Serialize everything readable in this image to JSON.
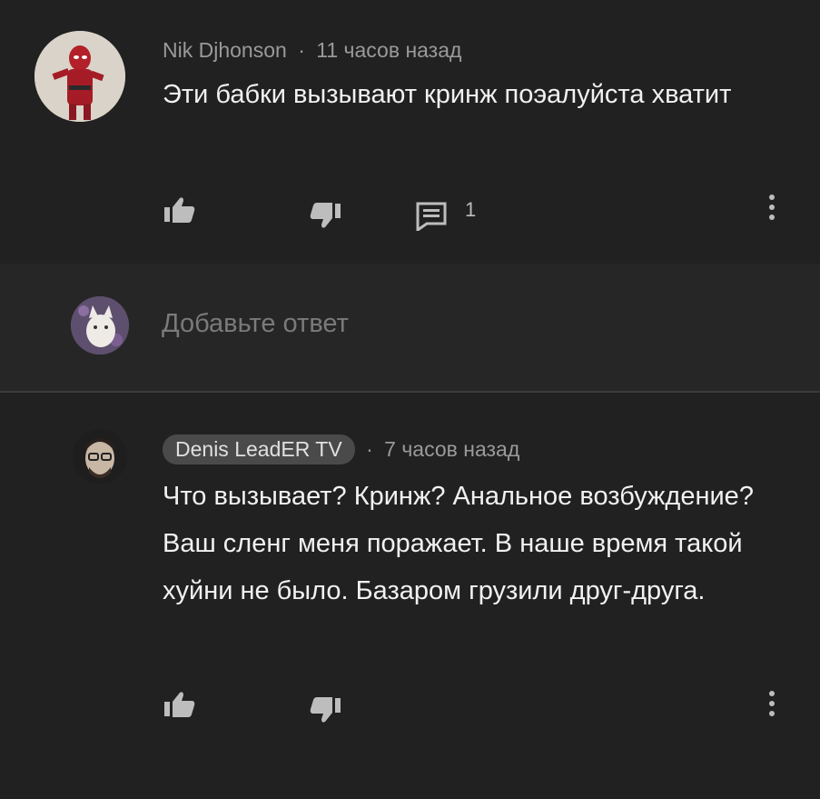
{
  "comment1": {
    "author": "Nik Djhonson",
    "separator": "·",
    "time": "11 часов назад",
    "text": "Эти бабки вызывают кринж поэалуйста хватит",
    "reply_count": "1"
  },
  "reply_input": {
    "placeholder": "Добавьте ответ"
  },
  "comment2": {
    "author": "Denis LeadER TV",
    "separator": "·",
    "time": "7 часов назад",
    "text": "Что вызывает? Кринж? Анальное возбуждение? Ваш сленг меня поражает. В наше время такой хуйни не было. Базаром грузили друг-друга."
  },
  "icons": {
    "like": "thumbs-up-icon",
    "dislike": "thumbs-down-icon",
    "replies": "comment-icon",
    "more": "more-vertical-icon"
  },
  "colors": {
    "background": "#212121",
    "reply_box": "#262626",
    "text": "#f1f1f1",
    "secondary_text": "#9a9a9a"
  }
}
